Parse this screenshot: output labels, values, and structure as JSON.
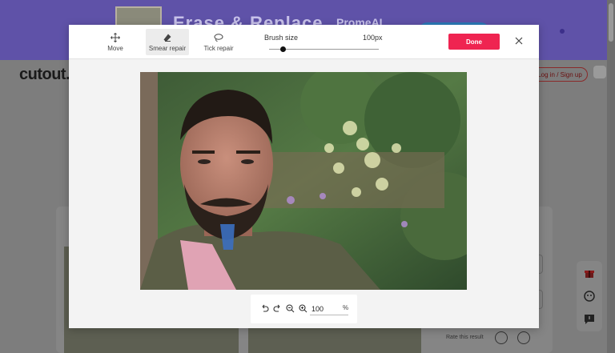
{
  "background": {
    "banner_title": "Erase & Replace",
    "banner_brand": "PromeAI",
    "logo": "cutout.",
    "login_label": "Log in / Sign up",
    "rate_label": "Rate this result"
  },
  "toolbar": {
    "tools": [
      {
        "label": "Move",
        "icon": "move-icon",
        "active": false
      },
      {
        "label": "Smear repair",
        "icon": "eraser-icon",
        "active": true
      },
      {
        "label": "Tick repair",
        "icon": "lasso-icon",
        "active": false
      }
    ],
    "brush_size_label": "Brush size",
    "brush_size_value": "100px",
    "brush_level": 0.1,
    "done_label": "Done"
  },
  "zoom": {
    "value": "100",
    "unit": "%"
  },
  "colors": {
    "accent": "#ef2451",
    "overlay": "#7d7d7d",
    "banner": "#5f52a8",
    "brush_mark": "#3b6fc0"
  }
}
